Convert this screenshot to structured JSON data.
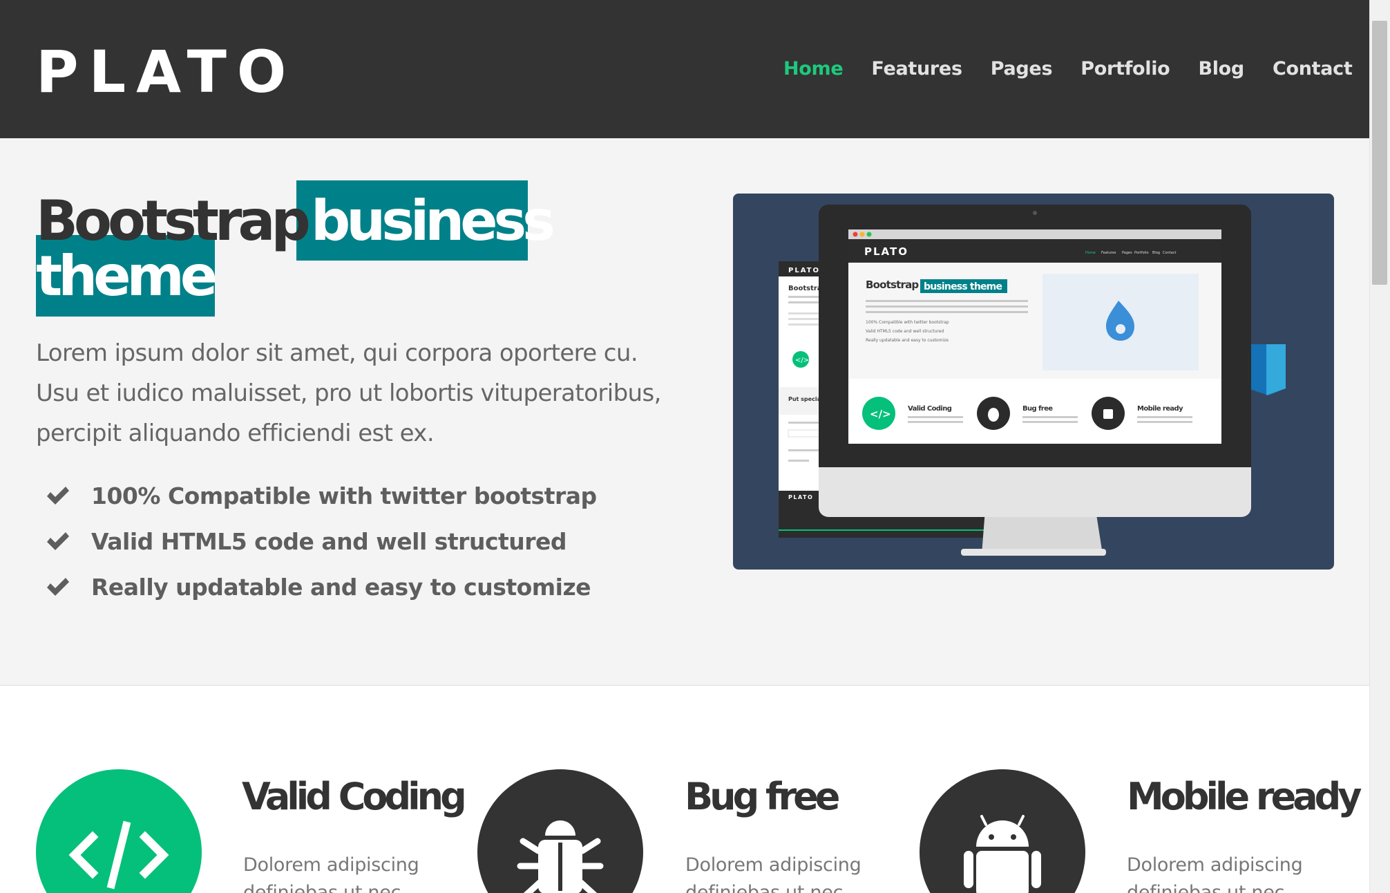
{
  "brand": {
    "logo": "PLATO"
  },
  "nav": {
    "items": [
      {
        "label": "Home",
        "active": true
      },
      {
        "label": "Features",
        "active": false
      },
      {
        "label": "Pages",
        "active": false
      },
      {
        "label": "Portfolio",
        "active": false
      },
      {
        "label": "Blog",
        "active": false
      },
      {
        "label": "Contact",
        "active": false
      }
    ]
  },
  "hero": {
    "title_plain": "Bootstrap",
    "title_highlight_1": "business",
    "title_highlight_2": "theme",
    "lead": "Lorem ipsum dolor sit amet, qui corpora oportere cu. Usu et iudico maluisset, pro ut lobortis vituperatoribus, percipit aliquando efficiendi est ex.",
    "bullets": [
      "100% Compatible with twitter bootstrap",
      "Valid HTML5 code and well structured",
      "Really updatable and easy to customize"
    ],
    "check_icon": "check-icon"
  },
  "mockup": {
    "screen_logo": "PLATO",
    "screen_nav": [
      "Home",
      "Features",
      "Pages",
      "Portfolio",
      "Blog",
      "Contact"
    ],
    "screen_title_plain": "Bootstrap",
    "screen_title_highlight": "business theme",
    "screen_lead": "Lorem ipsum dolor sit amet, qui corpora oportere cu. Usu et iudico maluisset, pro ut lobortis vituperatoribus, percipit aliquando efficiendi est ex.",
    "screen_bullets": [
      "100% Compatible with twitter bootstrap",
      "Valid HTML5 code and well structured",
      "Really updatable and easy to customize"
    ],
    "screen_features": [
      "Valid Coding",
      "Bug free",
      "Mobile ready"
    ],
    "tablet_logo": "PLATO",
    "tablet_title": "Bootstrap",
    "tablet_section": "Put special",
    "tablet_footer_logo": "PLATO",
    "colors": {
      "bg": "#34455f",
      "accent": "#008189",
      "green": "#1ec97d"
    }
  },
  "features": [
    {
      "title": "Valid Coding",
      "text": "Dolorem adipiscing definiebas ut nec.",
      "icon": "code-icon",
      "color": "#05c07a"
    },
    {
      "title": "Bug free",
      "text": "Dolorem adipiscing definiebas ut nec.",
      "icon": "bug-icon",
      "color": "#333333"
    },
    {
      "title": "Mobile ready",
      "text": "Dolorem adipiscing definiebas ut nec.",
      "icon": "android-icon",
      "color": "#333333"
    }
  ],
  "colors": {
    "header": "#333333",
    "accent": "#008189",
    "nav_active": "#1ec97d",
    "hero_bg": "#f4f4f5"
  }
}
